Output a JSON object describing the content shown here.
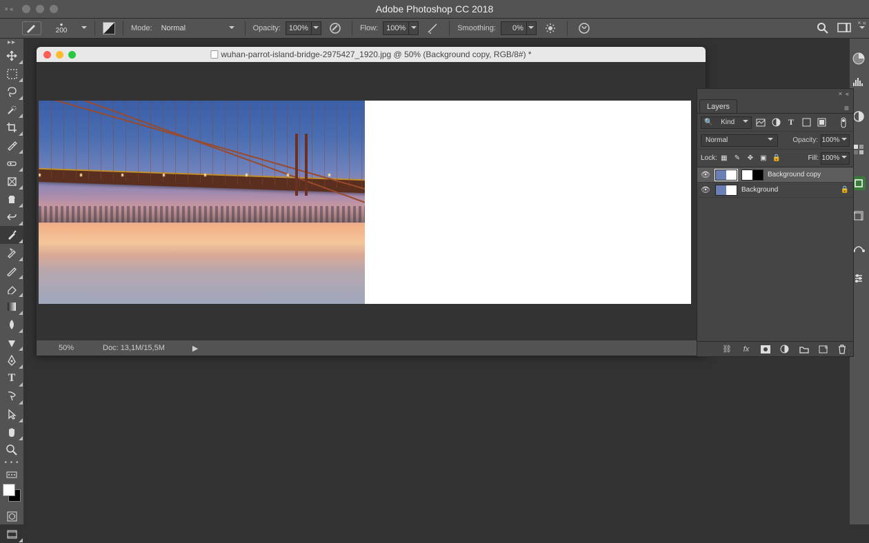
{
  "app": {
    "title": "Adobe Photoshop CC 2018"
  },
  "options": {
    "brushSize": "200",
    "modeLabel": "Mode:",
    "modeValue": "Normal",
    "opacityLabel": "Opacity:",
    "opacityValue": "100%",
    "flowLabel": "Flow:",
    "flowValue": "100%",
    "smoothingLabel": "Smoothing:",
    "smoothingValue": "0%"
  },
  "document": {
    "title": "wuhan-parrot-island-bridge-2975427_1920.jpg @ 50% (Background copy, RGB/8#) *",
    "zoom": "50%",
    "docSizeLabel": "Doc:",
    "docSize": "13,1M/15,5M"
  },
  "layersPanel": {
    "tab": "Layers",
    "kindLabel": "Kind",
    "blendValue": "Normal",
    "opacityLabel": "Opacity:",
    "opacityValue": "100%",
    "lockLabel": "Lock:",
    "fillLabel": "Fill:",
    "fillValue": "100%",
    "layers": [
      {
        "name": "Background copy",
        "selected": true,
        "hasMask": true,
        "locked": false
      },
      {
        "name": "Background",
        "selected": false,
        "hasMask": false,
        "locked": true
      }
    ]
  }
}
